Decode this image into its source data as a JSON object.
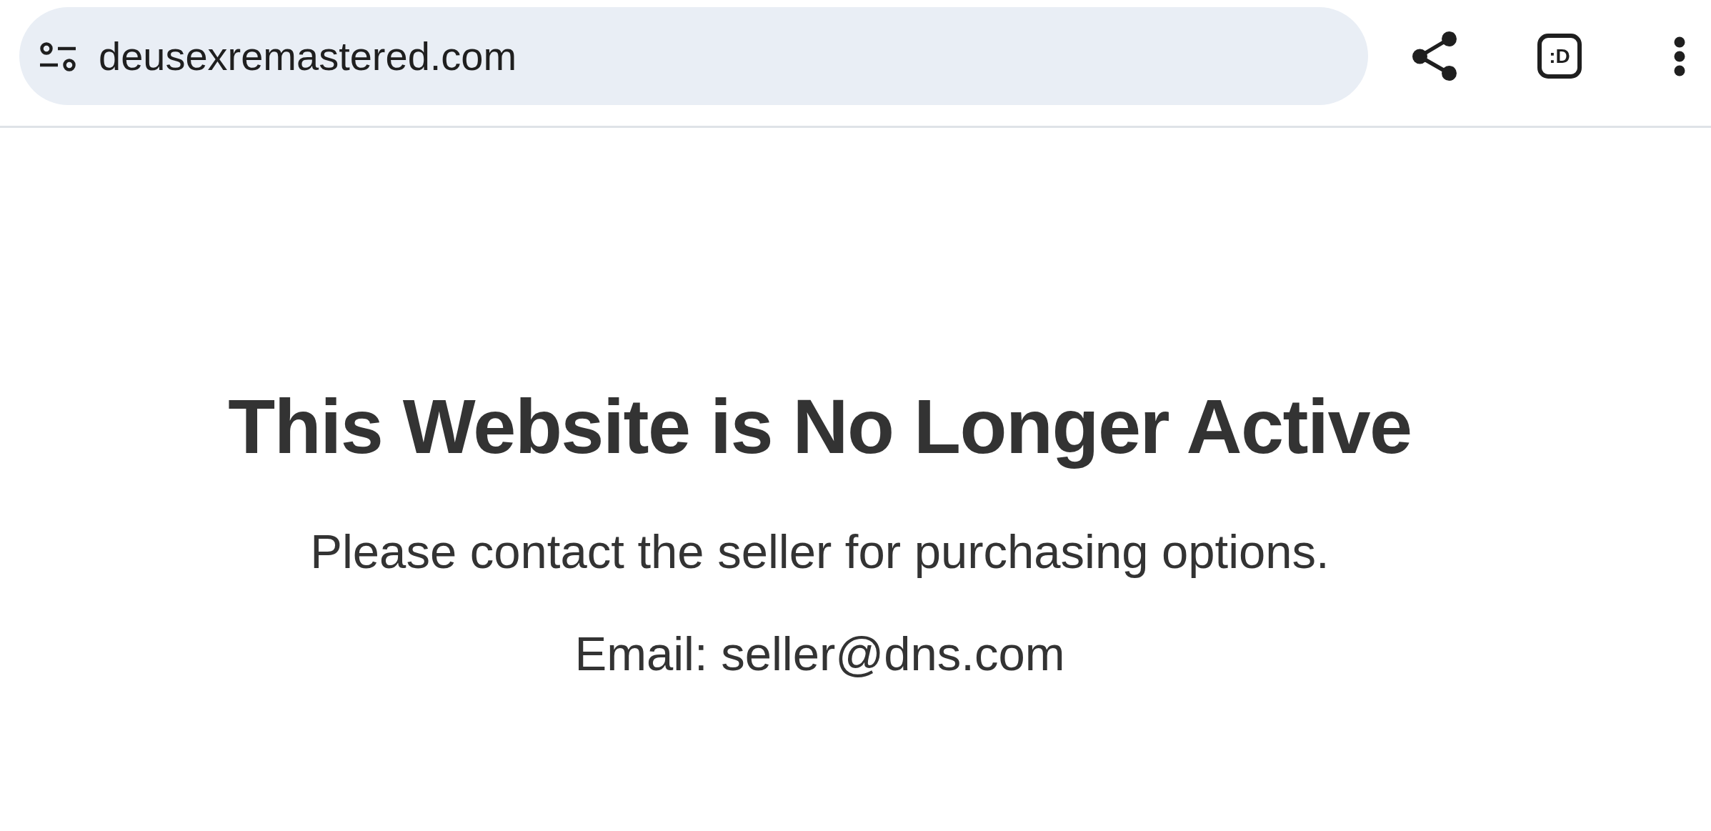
{
  "address_bar": {
    "url": "deusexremastered.com"
  },
  "emoticon_button": {
    "label": ":D"
  },
  "page": {
    "heading": "This Website is No Longer Active",
    "message": "Please contact the seller for purchasing options.",
    "email": "Email: seller@dns.com"
  }
}
